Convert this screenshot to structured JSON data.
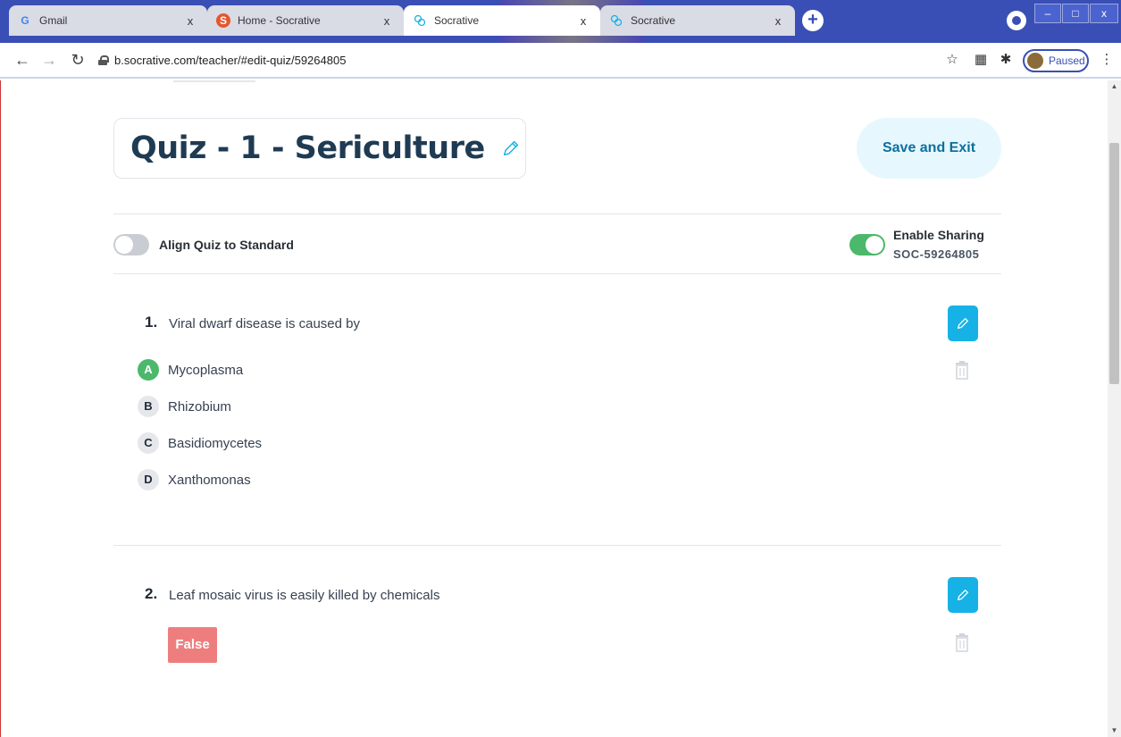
{
  "browser": {
    "tabs": [
      {
        "title": "Gmail",
        "favicon": "G"
      },
      {
        "title": "Home - Socrative",
        "favicon": "S"
      },
      {
        "title": "Socrative",
        "favicon": "socrative-icon"
      },
      {
        "title": "Socrative",
        "favicon": "socrative-icon"
      }
    ],
    "close_glyph": "x",
    "url": "b.socrative.com/teacher/#edit-quiz/59264805",
    "profile_label": "Paused"
  },
  "quiz": {
    "title": "Quiz - 1 - Sericulture",
    "save_exit_label": "Save and Exit",
    "align_label": "Align Quiz to Standard",
    "align_enabled": false,
    "sharing_label": "Enable Sharing",
    "sharing_enabled": true,
    "sharing_code": "SOC-59264805"
  },
  "questions": [
    {
      "number": "1.",
      "text": "Viral dwarf disease is caused by",
      "choices": [
        {
          "letter": "A",
          "text": "Mycoplasma",
          "correct": true
        },
        {
          "letter": "B",
          "text": " Rhizobium",
          "correct": false
        },
        {
          "letter": "C",
          "text": "Basidiomycetes",
          "correct": false
        },
        {
          "letter": "D",
          "text": "Xanthomonas",
          "correct": false
        }
      ]
    },
    {
      "number": "2.",
      "text": "Leaf mosaic virus is easily killed by chemicals",
      "answer": "False"
    }
  ],
  "colors": {
    "accent": "#16b2e6",
    "correct": "#4cb86b",
    "false_badge": "#ee7e7e",
    "title": "#1f3b53"
  }
}
